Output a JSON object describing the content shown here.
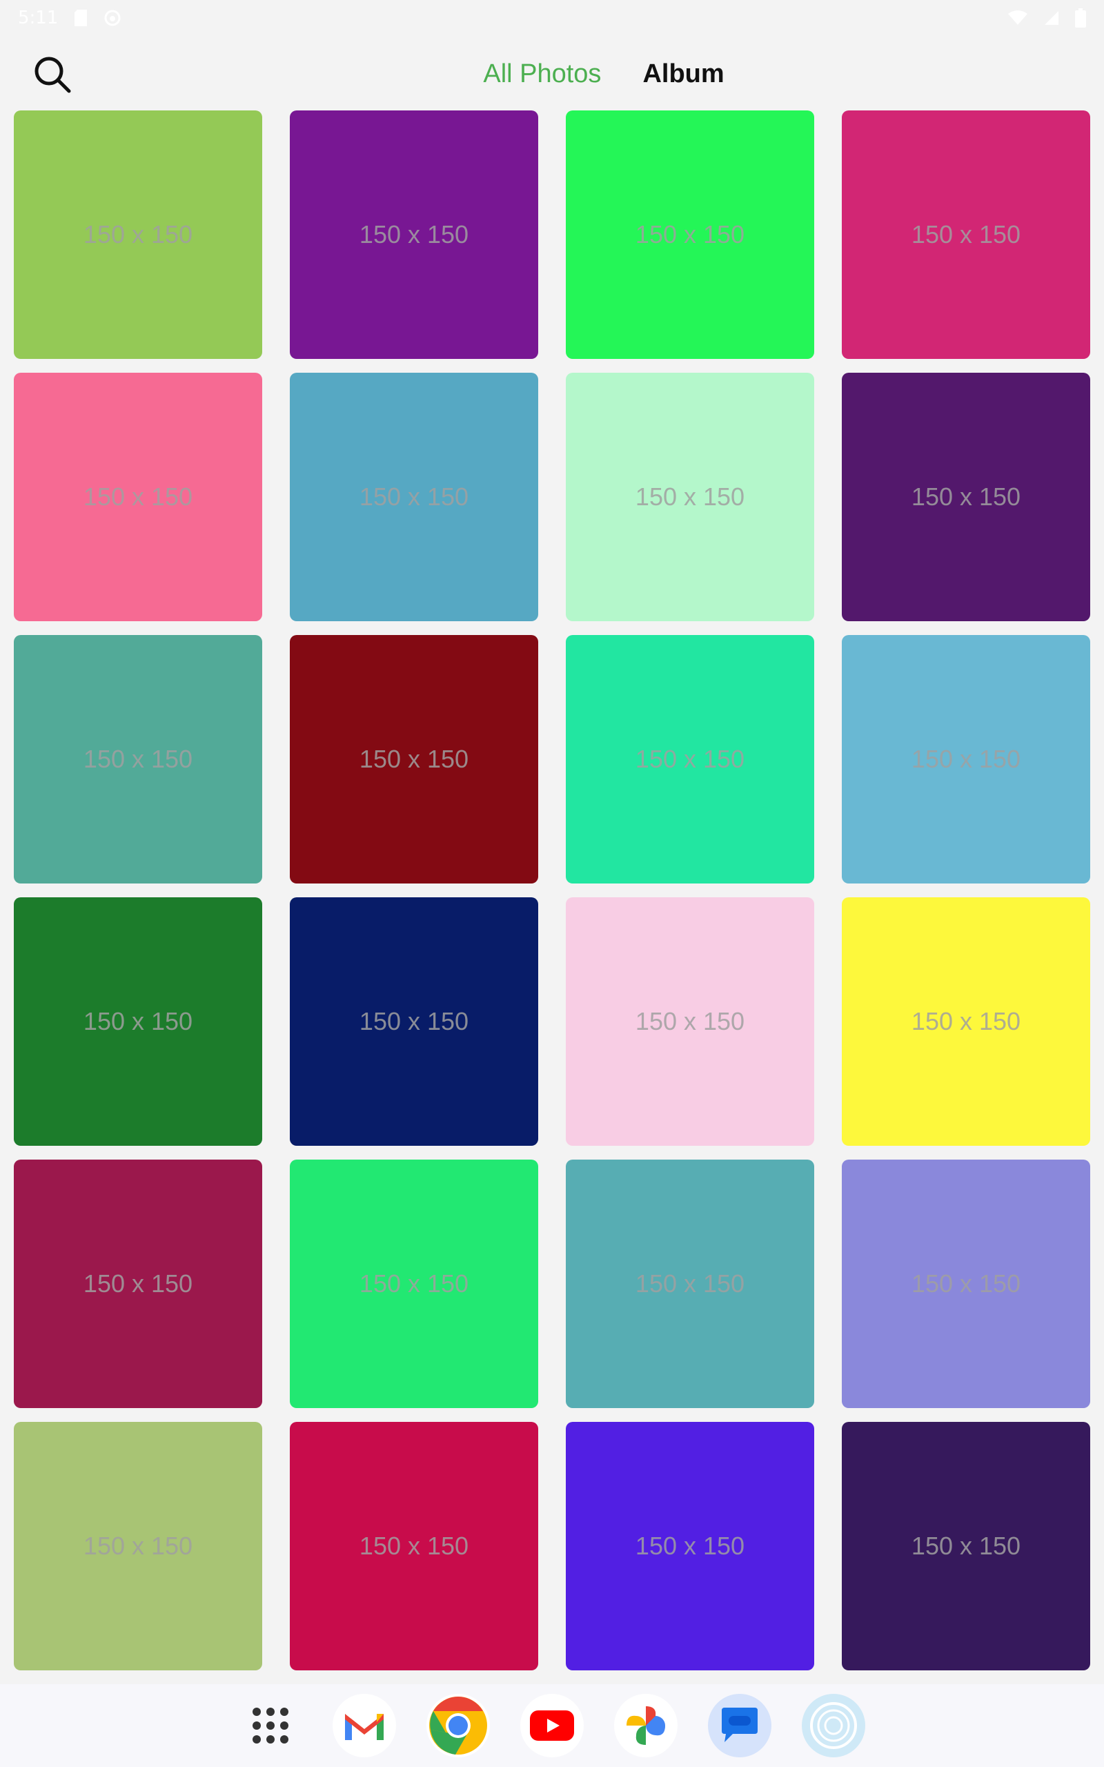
{
  "status_bar": {
    "time": "5:11",
    "left_icons": [
      "sd-card-icon",
      "shield-icon"
    ],
    "right_icons": [
      "wifi-icon",
      "cell-signal-icon",
      "battery-icon"
    ]
  },
  "header": {
    "search_icon": "search-icon",
    "tabs": [
      {
        "label": "All Photos",
        "active": true,
        "color": "#4caf50"
      },
      {
        "label": "Album",
        "active": false
      }
    ]
  },
  "grid": {
    "tiles": [
      {
        "label": "150 x 150",
        "color": "#94c956"
      },
      {
        "label": "150 x 150",
        "color": "#781793"
      },
      {
        "label": "150 x 150",
        "color": "#24f657"
      },
      {
        "label": "150 x 150",
        "color": "#d22674"
      },
      {
        "label": "150 x 150",
        "color": "#f66a93"
      },
      {
        "label": "150 x 150",
        "color": "#56a8c3"
      },
      {
        "label": "150 x 150",
        "color": "#b4f7cb"
      },
      {
        "label": "150 x 150",
        "color": "#53186c"
      },
      {
        "label": "150 x 150",
        "color": "#52aa98"
      },
      {
        "label": "150 x 150",
        "color": "#830a13"
      },
      {
        "label": "150 x 150",
        "color": "#22e6a1"
      },
      {
        "label": "150 x 150",
        "color": "#69b8d3"
      },
      {
        "label": "150 x 150",
        "color": "#1c7c2b"
      },
      {
        "label": "150 x 150",
        "color": "#081c68"
      },
      {
        "label": "150 x 150",
        "color": "#f8cde4"
      },
      {
        "label": "150 x 150",
        "color": "#fdf83c"
      },
      {
        "label": "150 x 150",
        "color": "#9b184c"
      },
      {
        "label": "150 x 150",
        "color": "#22e872"
      },
      {
        "label": "150 x 150",
        "color": "#57adb3"
      },
      {
        "label": "150 x 150",
        "color": "#8a88db"
      },
      {
        "label": "150 x 150",
        "color": "#a8c474"
      },
      {
        "label": "150 x 150",
        "color": "#c80c4b"
      },
      {
        "label": "150 x 150",
        "color": "#521fe3"
      },
      {
        "label": "150 x 150",
        "color": "#36195c"
      }
    ]
  },
  "dock": {
    "apps": [
      "app-drawer-icon",
      "gmail-icon",
      "chrome-icon",
      "youtube-icon",
      "photos-icon",
      "messages-icon",
      "assistant-icon"
    ]
  }
}
